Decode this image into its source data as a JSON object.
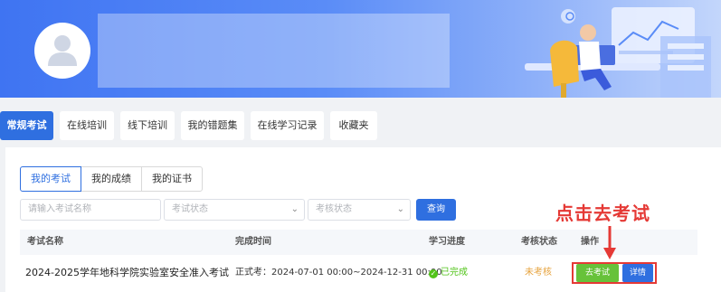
{
  "tabs": [
    {
      "label": "常规考试",
      "active": true
    },
    {
      "label": "在线培训",
      "active": false
    },
    {
      "label": "线下培训",
      "active": false
    },
    {
      "label": "我的错题集",
      "active": false
    },
    {
      "label": "在线学习记录",
      "active": false
    },
    {
      "label": "收藏夹",
      "active": false
    }
  ],
  "subtabs": [
    {
      "label": "我的考试",
      "active": true
    },
    {
      "label": "我的成绩",
      "active": false
    },
    {
      "label": "我的证书",
      "active": false
    }
  ],
  "filters": {
    "name_placeholder": "请输入考试名称",
    "exam_status_placeholder": "考试状态",
    "review_status_placeholder": "考核状态",
    "query_label": "查询"
  },
  "table": {
    "headers": [
      "考试名称",
      "完成时间",
      "学习进度",
      "考核状态",
      "操作"
    ],
    "rows": [
      {
        "name": "2024-2025学年地科学院实验室安全准入考试",
        "time": "正式考：2024-07-01 00:00~2024-12-31 00:00",
        "progress": "已完成",
        "status": "未考核",
        "action_go": "去考试",
        "action_detail": "详情"
      }
    ]
  },
  "annotation": "点击去考试",
  "colors": {
    "primary": "#2f6fe0",
    "success": "#67c23a",
    "warning": "#e6a23c",
    "annotation": "#e53935"
  }
}
